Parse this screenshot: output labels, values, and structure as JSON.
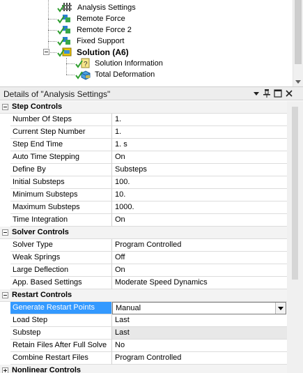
{
  "tree": {
    "items": [
      {
        "label": "Analysis Settings",
        "icon": "analysis-settings-icon",
        "bold": false
      },
      {
        "label": "Remote Force",
        "icon": "remote-force-icon",
        "bold": false
      },
      {
        "label": "Remote Force 2",
        "icon": "remote-force-icon",
        "bold": false
      },
      {
        "label": "Fixed Support",
        "icon": "fixed-support-icon",
        "bold": false
      },
      {
        "label": "Solution (A6)",
        "icon": "solution-icon",
        "bold": true
      },
      {
        "label": "Solution Information",
        "icon": "solution-information-icon",
        "bold": false
      },
      {
        "label": "Total Deformation",
        "icon": "total-deformation-icon",
        "bold": false
      }
    ]
  },
  "details": {
    "title": "Details of \"Analysis Settings\"",
    "pin_glyph": "−",
    "pushpin_glyph": "q",
    "groups": [
      {
        "label": "Step Controls",
        "expanded": true,
        "rows": [
          {
            "name": "Number Of Steps",
            "value": "1."
          },
          {
            "name": "Current Step Number",
            "value": "1."
          },
          {
            "name": "Step End Time",
            "value": "1. s"
          },
          {
            "name": "Auto Time Stepping",
            "value": "On"
          },
          {
            "name": "Define By",
            "value": "Substeps"
          },
          {
            "name": "Initial Substeps",
            "value": "100."
          },
          {
            "name": "Minimum Substeps",
            "value": "10."
          },
          {
            "name": "Maximum Substeps",
            "value": "1000."
          },
          {
            "name": "Time Integration",
            "value": "On"
          }
        ]
      },
      {
        "label": "Solver Controls",
        "expanded": true,
        "rows": [
          {
            "name": "Solver Type",
            "value": "Program Controlled"
          },
          {
            "name": "Weak Springs",
            "value": "Off"
          },
          {
            "name": "Large Deflection",
            "value": "On"
          },
          {
            "name": "App. Based Settings",
            "value": "Moderate Speed Dynamics"
          }
        ]
      },
      {
        "label": "Restart Controls",
        "expanded": true,
        "rows": [
          {
            "name": "Generate Restart Points",
            "value": "Manual",
            "selected": true,
            "dropdown": true
          },
          {
            "name": "Load Step",
            "value": "Last"
          },
          {
            "name": "Substep",
            "value": "Last",
            "readonly": true
          },
          {
            "name": "Retain Files After Full Solve",
            "value": "No"
          },
          {
            "name": "Combine Restart Files",
            "value": "Program Controlled"
          }
        ]
      },
      {
        "label": "Nonlinear Controls",
        "expanded": false,
        "rows": []
      }
    ]
  },
  "colors": {
    "selection": "#3399ff",
    "check_green": "#2e9e2e",
    "group_bg": "#f3f3f3"
  }
}
